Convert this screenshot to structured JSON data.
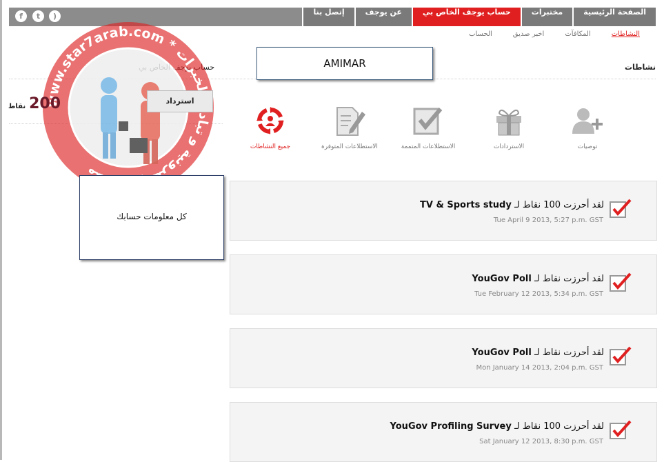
{
  "social": {
    "icons": [
      "facebook-icon",
      "twitter-icon",
      "rss-icon"
    ]
  },
  "nav": {
    "items": [
      {
        "label": "الصفحة الرئيسية",
        "active": false
      },
      {
        "label": "مختبرات",
        "active": false
      },
      {
        "label": "حساب يوجف الخاص بي",
        "active": true
      },
      {
        "label": "عن يوجف",
        "active": false
      },
      {
        "label": "إتصل بنا",
        "active": false
      }
    ]
  },
  "subnav": {
    "items": [
      {
        "label": "النشاطات",
        "active": true
      },
      {
        "label": "المكافآت",
        "active": false
      },
      {
        "label": "اخبر صديق",
        "active": false
      },
      {
        "label": "الحساب",
        "active": false
      }
    ]
  },
  "activity": {
    "title": "نشاطات"
  },
  "account": {
    "title": "حساب يوجف الخاص بي"
  },
  "user": {
    "name": "AMIMAR"
  },
  "points": {
    "value": "200",
    "label": "نقاط"
  },
  "redeem": {
    "label": "استرداد"
  },
  "filters": [
    {
      "label": "توصيات",
      "icon": "add-user-icon",
      "active": false
    },
    {
      "label": "الاستردادات",
      "icon": "gift-icon",
      "active": false
    },
    {
      "label": "الاستطلاعات المتممة",
      "icon": "checkbox-icon",
      "active": false
    },
    {
      "label": "الاستطلاعات المتوفرة",
      "icon": "edit-icon",
      "active": false
    },
    {
      "label": "جميع النشاطات",
      "icon": "all-activities-icon",
      "active": true
    }
  ],
  "activities": [
    {
      "prefix": "لقد أحرزت 100 نقاط لـ",
      "survey": "TV & Sports study",
      "date": "Tue April 9 2013, 5:27 p.m. GST"
    },
    {
      "prefix": "لقد أحرزت نقاط لـ",
      "survey": "YouGov Poll",
      "date": "Tue February 12 2013, 5:34 p.m. GST"
    },
    {
      "prefix": "لقد أحرزت نقاط لـ",
      "survey": "YouGov Poll",
      "date": "Mon January 14 2013, 2:04 p.m. GST"
    },
    {
      "prefix": "لقد أحرزت 100 نقاط لـ",
      "survey": "YouGov Profiling Survey",
      "date": "Sat January 12 2013, 8:30 p.m. GST"
    }
  ],
  "info_box": {
    "text": "كل معلومات حسابك"
  },
  "watermark": {
    "text": "www.star7arab.com * منتدى الإلكترونية و تبادل الخبرات"
  },
  "colors": {
    "accent": "#e02020",
    "nav_bg": "#8c8c8c",
    "card_bg": "#f4f4f4"
  }
}
